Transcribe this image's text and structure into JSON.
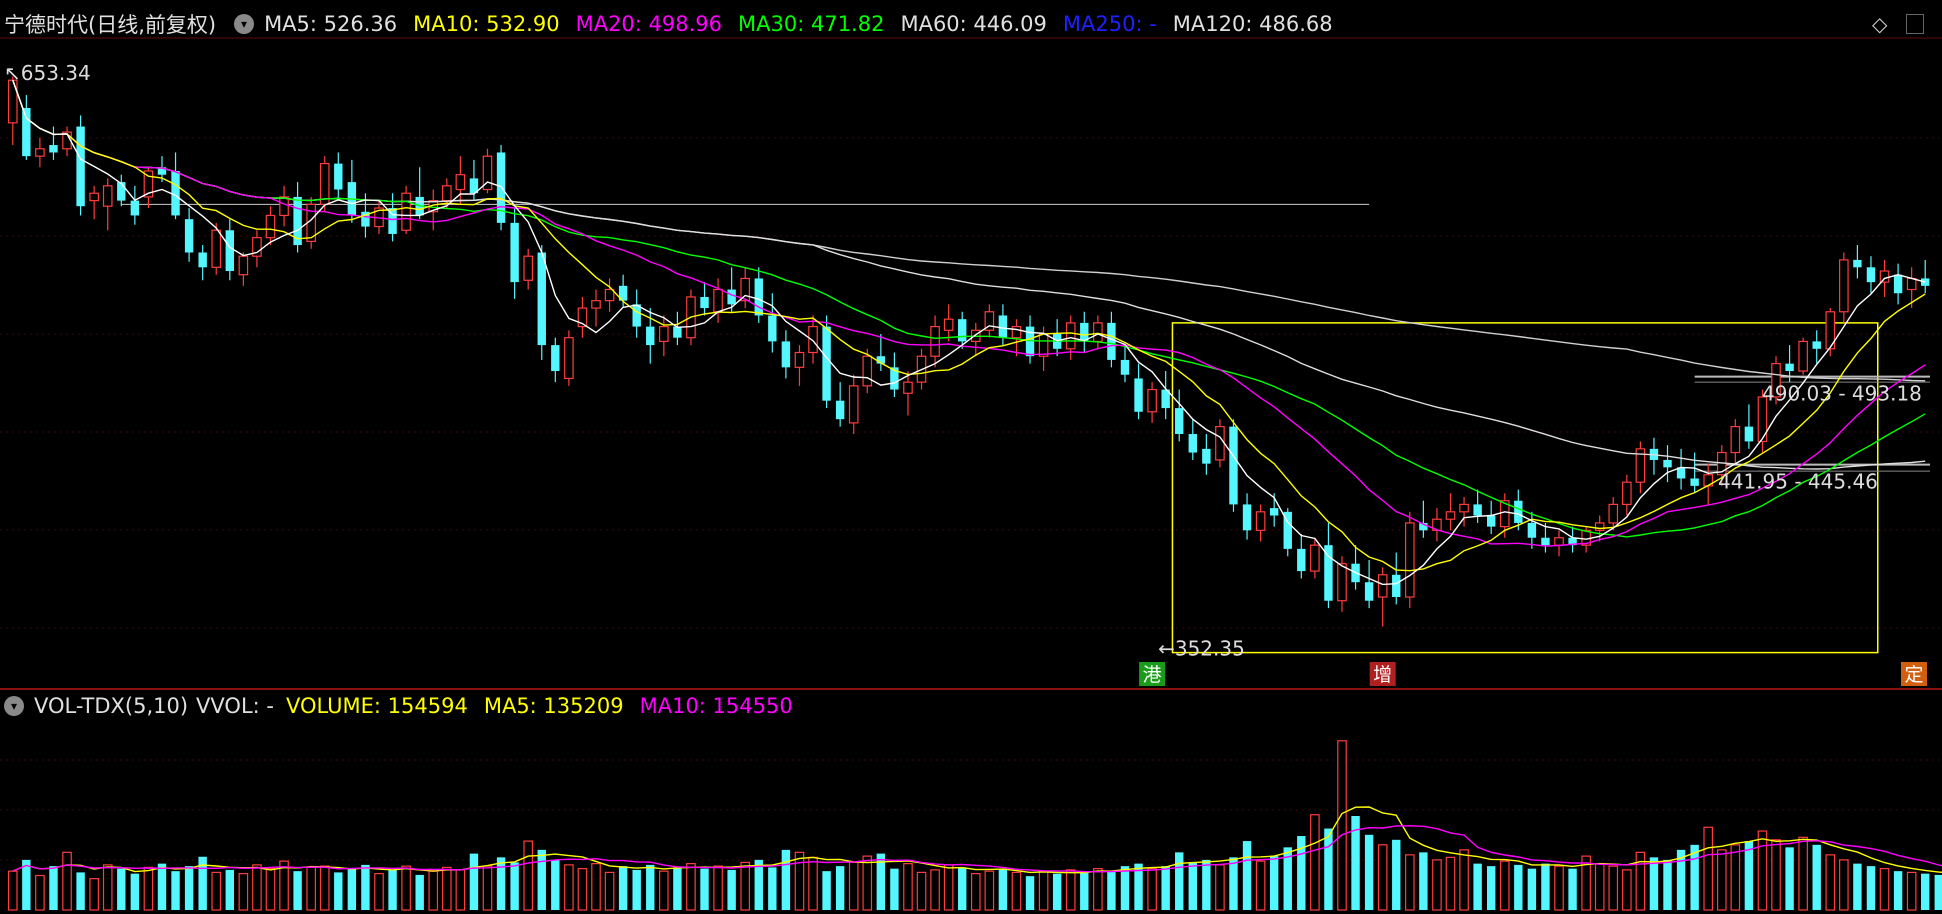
{
  "colors": {
    "up": "#ff3d3d",
    "down": "#54f6ff",
    "ma5": "#ffffff",
    "ma10": "#ffff00",
    "ma20": "#ff00ff",
    "ma30": "#00ff00",
    "ma60": "#ffffff",
    "ma250": "#0000ff",
    "ma120": "#ffffff",
    "box": "#ffff00",
    "bg": "#000000"
  },
  "header": {
    "title": "宁德时代(日线,前复权)",
    "ma5": "MA5: 526.36",
    "ma10": "MA10: 532.90",
    "ma20": "MA20: 498.96",
    "ma30": "MA30: 471.82",
    "ma60": "MA60: 446.09",
    "ma250": "MA250: -",
    "ma120": "MA120: 486.68",
    "menu_icon": "chevron-down-icon",
    "corner_icon": "diamond-icon"
  },
  "vol_header": {
    "title": "VOL-TDX(5,10)",
    "vvol": "VVOL: -",
    "volume": "VOLUME: 154594",
    "ma5": "MA5: 135209",
    "ma10": "MA10: 154550"
  },
  "chart_data": [
    {
      "type": "candlestick",
      "title": "宁德时代(日线,前复权)",
      "ylim": [
        340,
        665
      ],
      "annotations": [
        {
          "text": "653.34",
          "kind": "high"
        },
        {
          "text": "352.35",
          "kind": "low"
        },
        {
          "text": "490.03 - 493.18",
          "kind": "price-band"
        },
        {
          "text": "441.95 - 445.46",
          "kind": "price-band"
        }
      ],
      "event_markers": [
        {
          "text": "港",
          "color": "#1a9c1a"
        },
        {
          "text": "增",
          "color": "#b02020"
        },
        {
          "text": "定",
          "color": "#d06010"
        }
      ],
      "candles": [
        [
          630,
          655,
          618,
          653
        ],
        [
          638,
          645,
          610,
          612
        ],
        [
          612,
          622,
          606,
          616
        ],
        [
          618,
          628,
          610,
          614
        ],
        [
          616,
          628,
          612,
          625
        ],
        [
          628,
          634,
          580,
          585
        ],
        [
          588,
          596,
          578,
          592
        ],
        [
          585,
          600,
          572,
          596
        ],
        [
          598,
          602,
          585,
          588
        ],
        [
          588,
          596,
          575,
          580
        ],
        [
          590,
          606,
          584,
          604
        ],
        [
          606,
          612,
          598,
          602
        ],
        [
          604,
          614,
          578,
          580
        ],
        [
          578,
          584,
          555,
          560
        ],
        [
          560,
          564,
          545,
          552
        ],
        [
          552,
          576,
          548,
          572
        ],
        [
          572,
          578,
          545,
          550
        ],
        [
          548,
          560,
          542,
          558
        ],
        [
          558,
          572,
          552,
          568
        ],
        [
          568,
          585,
          564,
          580
        ],
        [
          580,
          596,
          574,
          590
        ],
        [
          590,
          598,
          560,
          564
        ],
        [
          566,
          590,
          562,
          586
        ],
        [
          586,
          612,
          582,
          608
        ],
        [
          608,
          614,
          588,
          594
        ],
        [
          598,
          610,
          576,
          580
        ],
        [
          582,
          592,
          568,
          574
        ],
        [
          574,
          588,
          570,
          584
        ],
        [
          584,
          592,
          566,
          570
        ],
        [
          572,
          596,
          570,
          592
        ],
        [
          590,
          606,
          578,
          580
        ],
        [
          582,
          594,
          572,
          588
        ],
        [
          588,
          600,
          584,
          596
        ],
        [
          594,
          612,
          586,
          602
        ],
        [
          600,
          610,
          588,
          592
        ],
        [
          594,
          616,
          592,
          612
        ],
        [
          614,
          618,
          572,
          576
        ],
        [
          576,
          584,
          535,
          544
        ],
        [
          545,
          562,
          540,
          558
        ],
        [
          560,
          564,
          502,
          510
        ],
        [
          510,
          514,
          490,
          496
        ],
        [
          492,
          518,
          488,
          514
        ],
        [
          520,
          536,
          514,
          530
        ],
        [
          530,
          540,
          520,
          534
        ],
        [
          534,
          546,
          528,
          540
        ],
        [
          542,
          548,
          530,
          534
        ],
        [
          532,
          540,
          514,
          520
        ],
        [
          520,
          530,
          500,
          510
        ],
        [
          512,
          526,
          504,
          520
        ],
        [
          520,
          528,
          510,
          514
        ],
        [
          514,
          540,
          510,
          536
        ],
        [
          536,
          544,
          526,
          530
        ],
        [
          528,
          546,
          522,
          540
        ],
        [
          540,
          552,
          528,
          532
        ],
        [
          534,
          552,
          530,
          546
        ],
        [
          546,
          552,
          522,
          526
        ],
        [
          526,
          538,
          506,
          512
        ],
        [
          512,
          518,
          492,
          498
        ],
        [
          498,
          510,
          488,
          506
        ],
        [
          506,
          526,
          500,
          520
        ],
        [
          520,
          526,
          476,
          480
        ],
        [
          480,
          490,
          466,
          470
        ],
        [
          468,
          494,
          462,
          488
        ],
        [
          488,
          508,
          484,
          504
        ],
        [
          504,
          516,
          496,
          500
        ],
        [
          498,
          506,
          482,
          486
        ],
        [
          484,
          496,
          472,
          490
        ],
        [
          490,
          508,
          486,
          504
        ],
        [
          504,
          526,
          498,
          520
        ],
        [
          518,
          532,
          512,
          524
        ],
        [
          524,
          528,
          508,
          512
        ],
        [
          512,
          522,
          504,
          518
        ],
        [
          518,
          532,
          514,
          528
        ],
        [
          526,
          532,
          510,
          514
        ],
        [
          514,
          524,
          504,
          520
        ],
        [
          520,
          526,
          500,
          504
        ],
        [
          504,
          520,
          496,
          516
        ],
        [
          516,
          524,
          504,
          508
        ],
        [
          508,
          526,
          502,
          522
        ],
        [
          522,
          528,
          506,
          512
        ],
        [
          512,
          526,
          508,
          522
        ],
        [
          522,
          528,
          498,
          502
        ],
        [
          502,
          510,
          490,
          494
        ],
        [
          492,
          500,
          470,
          474
        ],
        [
          474,
          490,
          468,
          486
        ],
        [
          486,
          496,
          470,
          476
        ],
        [
          476,
          486,
          458,
          462
        ],
        [
          462,
          470,
          448,
          452
        ],
        [
          454,
          462,
          440,
          446
        ],
        [
          448,
          470,
          444,
          466
        ],
        [
          466,
          470,
          420,
          424
        ],
        [
          424,
          430,
          405,
          410
        ],
        [
          410,
          424,
          404,
          420
        ],
        [
          422,
          430,
          412,
          418
        ],
        [
          420,
          422,
          396,
          400
        ],
        [
          400,
          408,
          384,
          388
        ],
        [
          388,
          406,
          384,
          402
        ],
        [
          402,
          414,
          368,
          372
        ],
        [
          372,
          396,
          366,
          392
        ],
        [
          392,
          402,
          378,
          382
        ],
        [
          382,
          394,
          368,
          372
        ],
        [
          374,
          390,
          358,
          386
        ],
        [
          386,
          398,
          370,
          374
        ],
        [
          374,
          420,
          368,
          414
        ],
        [
          414,
          426,
          406,
          410
        ],
        [
          410,
          422,
          404,
          416
        ],
        [
          416,
          430,
          410,
          420
        ],
        [
          420,
          428,
          412,
          424
        ],
        [
          424,
          432,
          414,
          418
        ],
        [
          418,
          426,
          408,
          412
        ],
        [
          412,
          430,
          406,
          426
        ],
        [
          426,
          432,
          410,
          414
        ],
        [
          414,
          420,
          400,
          406
        ],
        [
          406,
          414,
          398,
          402
        ],
        [
          402,
          410,
          396,
          406
        ],
        [
          406,
          412,
          398,
          402
        ],
        [
          402,
          412,
          398,
          410
        ],
        [
          410,
          418,
          404,
          414
        ],
        [
          414,
          428,
          410,
          424
        ],
        [
          424,
          440,
          418,
          436
        ],
        [
          436,
          458,
          430,
          454
        ],
        [
          454,
          460,
          440,
          448
        ],
        [
          448,
          456,
          436,
          444
        ],
        [
          444,
          454,
          432,
          438
        ],
        [
          438,
          452,
          430,
          434
        ],
        [
          434,
          446,
          424,
          440
        ],
        [
          440,
          456,
          434,
          452
        ],
        [
          452,
          470,
          446,
          466
        ],
        [
          466,
          478,
          454,
          458
        ],
        [
          458,
          486,
          452,
          482
        ],
        [
          482,
          504,
          478,
          500
        ],
        [
          500,
          510,
          490,
          496
        ],
        [
          496,
          514,
          494,
          512
        ],
        [
          512,
          518,
          500,
          508
        ],
        [
          508,
          530,
          504,
          528
        ],
        [
          528,
          560,
          522,
          556
        ],
        [
          556,
          564,
          546,
          552
        ],
        [
          552,
          558,
          538,
          544
        ],
        [
          544,
          556,
          536,
          550
        ],
        [
          548,
          554,
          532,
          538
        ],
        [
          540,
          552,
          530,
          546
        ],
        [
          546,
          556,
          538,
          542
        ]
      ]
    },
    {
      "type": "bar",
      "title": "VOL-TDX(5,10)",
      "series": [
        {
          "name": "VOLUME",
          "values": [
            62,
            80,
            55,
            70,
            92,
            60,
            50,
            72,
            66,
            58,
            68,
            74,
            62,
            70,
            85,
            60,
            64,
            58,
            72,
            66,
            78,
            62,
            68,
            70,
            60,
            66,
            72,
            58,
            64,
            70,
            56,
            62,
            68,
            64,
            90,
            70,
            84,
            76,
            110,
            96,
            80,
            72,
            66,
            74,
            60,
            70,
            64,
            72,
            62,
            68,
            74,
            66,
            70,
            64,
            76,
            80,
            68,
            96,
            92,
            84,
            62,
            70,
            76,
            86,
            90,
            66,
            74,
            60,
            64,
            72,
            68,
            58,
            62,
            66,
            60,
            54,
            62,
            58,
            64,
            60,
            66,
            62,
            70,
            74,
            66,
            70,
            92,
            76,
            80,
            72,
            84,
            110,
            78,
            86,
            100,
            118,
            152,
            130,
            270,
            150,
            120,
            104,
            112,
            88,
            92,
            80,
            84,
            96,
            74,
            70,
            78,
            72,
            66,
            74,
            70,
            66,
            86,
            74,
            70,
            64,
            92,
            84,
            80,
            96,
            104,
            132,
            96,
            104,
            110,
            126,
            112,
            100,
            116,
            104,
            88,
            80,
            74,
            70,
            66,
            62,
            60,
            58,
            56,
            62
          ]
        }
      ],
      "ylim": [
        0,
        300
      ]
    }
  ]
}
